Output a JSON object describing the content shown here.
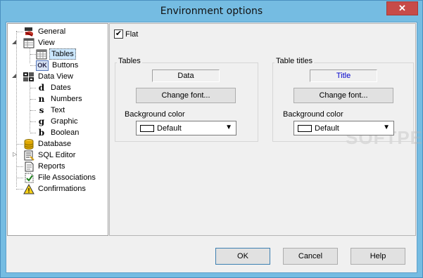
{
  "window": {
    "title": "Environment options",
    "close_glyph": "✕"
  },
  "tree": {
    "items": [
      {
        "label": "General",
        "icon": "general-icon"
      },
      {
        "label": "View",
        "icon": "view-icon"
      },
      {
        "label": "Tables",
        "icon": "tables-icon",
        "selected": true
      },
      {
        "label": "Buttons",
        "icon": "ok-buttons-icon",
        "icon_text": "OK"
      },
      {
        "label": "Data View",
        "icon": "data-view-icon"
      },
      {
        "label": "Dates",
        "icon": "dates-icon",
        "icon_text": "d"
      },
      {
        "label": "Numbers",
        "icon": "numbers-icon",
        "icon_text": "n"
      },
      {
        "label": "Text",
        "icon": "text-icon",
        "icon_text": "s"
      },
      {
        "label": "Graphic",
        "icon": "graphic-icon",
        "icon_text": "g"
      },
      {
        "label": "Boolean",
        "icon": "boolean-icon",
        "icon_text": "b"
      },
      {
        "label": "Database",
        "icon": "database-icon"
      },
      {
        "label": "SQL Editor",
        "icon": "sql-editor-icon"
      },
      {
        "label": "Reports",
        "icon": "reports-icon"
      },
      {
        "label": "File Associations",
        "icon": "file-associations-icon"
      },
      {
        "label": "Confirmations",
        "icon": "warning-icon",
        "icon_text": "!"
      }
    ]
  },
  "options": {
    "flat_label": "Flat",
    "flat_checked": true,
    "tables": {
      "group_label": "Tables",
      "sample_text": "Data",
      "change_font": "Change font...",
      "bg_label": "Background color",
      "bg_value": "Default",
      "sample_color": "#000000"
    },
    "titles": {
      "group_label": "Table titles",
      "sample_text": "Title",
      "change_font": "Change font...",
      "bg_label": "Background color",
      "bg_value": "Default",
      "sample_color": "#0000cc"
    }
  },
  "footer": {
    "ok": "OK",
    "cancel": "Cancel",
    "help": "Help"
  },
  "watermark": "SOFTPEDIA",
  "colors": {
    "titlebar": "#75bce2",
    "close": "#c74b48",
    "selection": "#cce8ff"
  }
}
